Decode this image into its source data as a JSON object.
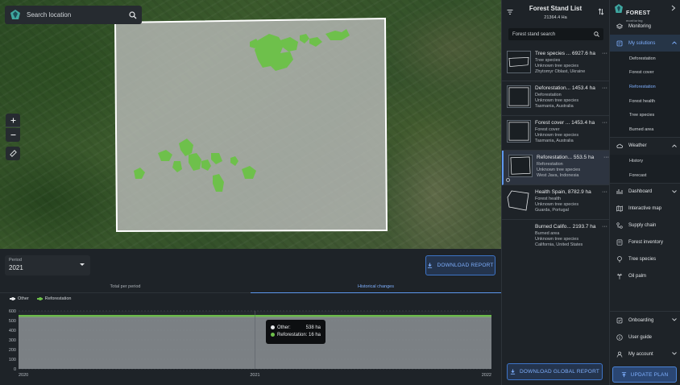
{
  "map": {
    "search_placeholder": "Search location",
    "controls": [
      "zoom-in",
      "zoom-out",
      "ruler"
    ]
  },
  "analytics": {
    "period_label": "Period",
    "period_value": "2021",
    "download_report": "DOWNLOAD REPORT",
    "tabs": [
      {
        "label": "Total per period",
        "active": false
      },
      {
        "label": "Historical changes",
        "active": true
      }
    ],
    "legend": [
      {
        "label": "Other",
        "color": "#e6e8ea"
      },
      {
        "label": "Reforestation",
        "color": "#6ec04b"
      }
    ],
    "tooltip": {
      "rows": [
        {
          "label": "Other:",
          "value": "538 ha",
          "color": "#e6e8ea"
        },
        {
          "label": "Reforestation:",
          "value": "16 ha",
          "color": "#6ec04b"
        }
      ]
    }
  },
  "chart_data": {
    "type": "area",
    "x": [
      "2020",
      "2021",
      "2022"
    ],
    "series": [
      {
        "name": "Other",
        "values": [
          538,
          538,
          538
        ],
        "color": "#8b8f94"
      },
      {
        "name": "Reforestation",
        "values": [
          16,
          16,
          16
        ],
        "color": "#6ec04b"
      }
    ],
    "stacked": true,
    "ylim": [
      0,
      600
    ],
    "yticks": [
      0,
      100,
      200,
      300,
      400,
      500,
      600
    ],
    "grid": true,
    "legend_position": "top-left"
  },
  "stand_list": {
    "title": "Forest Stand List",
    "total_area": "21364.4 Ha",
    "search_placeholder": "Forest stand search",
    "items": [
      {
        "name": "Tree species ...",
        "area": "6927.6 ha",
        "type": "Tree species",
        "species": "Unknown tree species",
        "location": "Zhytomyr Oblast, Ukraine",
        "selected": false
      },
      {
        "name": "Deforestation...",
        "area": "1453.4 ha",
        "type": "Deforestation",
        "species": "Unknown tree species",
        "location": "Tasmania, Australia",
        "selected": false
      },
      {
        "name": "Forest cover ...",
        "area": "1453.4 ha",
        "type": "Forest cover",
        "species": "Unknown tree species",
        "location": "Tasmania, Australia",
        "selected": false
      },
      {
        "name": "Reforestation...",
        "area": "553.5 ha",
        "type": "Reforestation",
        "species": "Unknown tree species",
        "location": "West Java, Indonesia",
        "selected": true
      },
      {
        "name": "Health Spain,",
        "area": "8782.9 ha",
        "type": "Forest health",
        "species": "Unknown tree species",
        "location": "Guarda, Portugal",
        "selected": false
      },
      {
        "name": "Burned Califo...",
        "area": "2193.7 ha",
        "type": "Burned area",
        "species": "Unknown tree species",
        "location": "California, United States",
        "selected": false
      }
    ],
    "download_global": "DOWNLOAD GLOBAL REPORT"
  },
  "sidebar": {
    "brand": "FOREST",
    "brand_sub": "monitoring",
    "items": [
      {
        "label": "Monitoring",
        "icon": "layers-icon"
      },
      {
        "label": "My solutions",
        "icon": "solutions-icon",
        "active": true,
        "expanded": true
      },
      {
        "label": "Weather",
        "icon": "cloud-icon",
        "expanded": true
      },
      {
        "label": "Dashboard",
        "icon": "dashboard-icon"
      },
      {
        "label": "Interactive map",
        "icon": "map-icon"
      },
      {
        "label": "Supply chain",
        "icon": "supply-chain-icon"
      },
      {
        "label": "Forest inventory",
        "icon": "inventory-icon"
      },
      {
        "label": "Tree species",
        "icon": "tree-icon"
      },
      {
        "label": "Oil palm",
        "icon": "palm-icon"
      }
    ],
    "solutions": [
      "Deforestation",
      "Forest cover",
      "Reforestation",
      "Forest health",
      "Tree species",
      "Burned area"
    ],
    "weather": [
      "History",
      "Forecast"
    ],
    "bottom": [
      {
        "label": "Onboarding",
        "icon": "onboarding-icon"
      },
      {
        "label": "User guide",
        "icon": "info-icon"
      },
      {
        "label": "My account",
        "icon": "user-icon"
      }
    ],
    "update_plan": "UPDATE PLAN"
  }
}
